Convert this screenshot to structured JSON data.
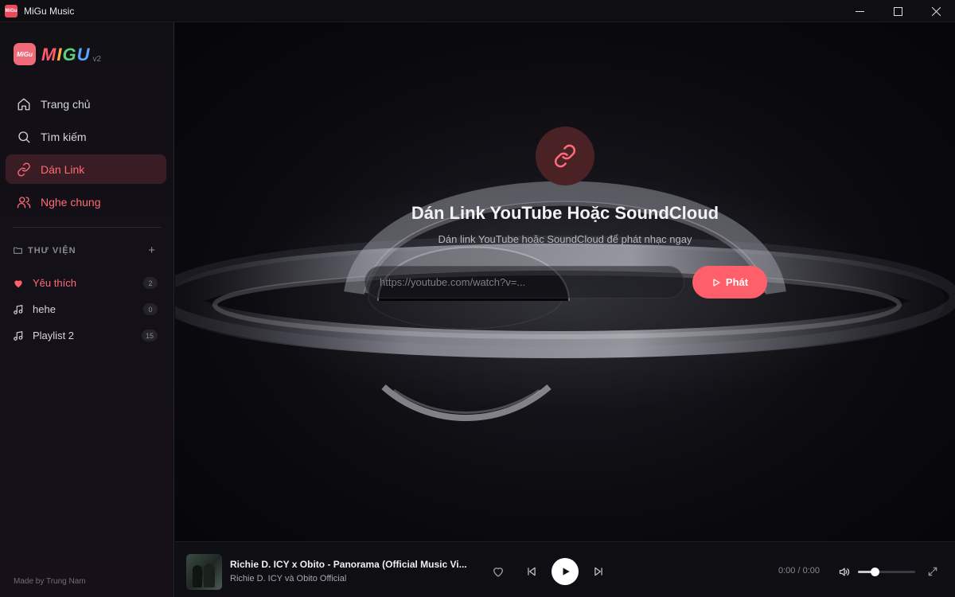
{
  "window": {
    "title": "MiGu Music",
    "app_icon_text": "MiGu"
  },
  "logo": {
    "badge_text": "MiGu",
    "letters": [
      "M",
      "I",
      "G",
      "U"
    ],
    "version": "v2"
  },
  "nav": {
    "items": [
      {
        "label": "Trang chủ",
        "icon": "home-icon"
      },
      {
        "label": "Tìm kiếm",
        "icon": "search-icon"
      },
      {
        "label": "Dán Link",
        "icon": "link-icon",
        "active": true
      },
      {
        "label": "Nghe chung",
        "icon": "users-icon"
      }
    ]
  },
  "library": {
    "header": "THƯ VIỆN",
    "add_symbol": "+",
    "playlists": [
      {
        "name": "Yêu thích",
        "count": "2",
        "icon": "heart-icon"
      },
      {
        "name": "hehe",
        "count": "0",
        "icon": "music-note-icon"
      },
      {
        "name": "Playlist 2",
        "count": "15",
        "icon": "music-note-icon"
      }
    ]
  },
  "footer": {
    "credit": "Made by Trung Nam"
  },
  "main": {
    "title": "Dán Link YouTube Hoặc SoundCloud",
    "subtitle": "Dán link YouTube hoặc SoundCloud để phát nhạc ngay",
    "input_placeholder": "https://youtube.com/watch?v=...",
    "play_label": "Phát"
  },
  "player": {
    "track_title": "Richie D. ICY x Obito - Panorama (Official Music Vi...",
    "artist": "Richie D. ICY và Obito Official",
    "time": "0:00 / 0:00",
    "volume": 0.3
  },
  "colors": {
    "accent": "#ff5f6a",
    "active_bg": "#3a1d24",
    "sidebar_bg": "#111015",
    "player_bg": "#0e0e13"
  }
}
